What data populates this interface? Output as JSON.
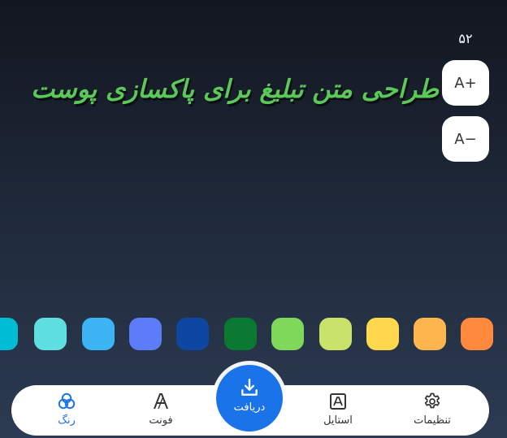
{
  "font_size": {
    "value": "۵۲",
    "increase_label": "A+",
    "decrease_label": "A−"
  },
  "canvas": {
    "text": "طراحی متن تبلیغ برای پاکسازی پوست",
    "text_color": "#5cc85a"
  },
  "palette": [
    "#00bcd4",
    "#5fdfe0",
    "#3db5f5",
    "#5c7cfa",
    "#0d47a1",
    "#0a7a33",
    "#7fd85a",
    "#c9e36a",
    "#ffd84d",
    "#ffb54d",
    "#ff8a3d"
  ],
  "nav": {
    "color": "رنگ",
    "font": "فونت",
    "download": "دریافت",
    "style": "استایل",
    "settings": "تنظیمات"
  },
  "colors": {
    "accent": "#1a73e8"
  }
}
